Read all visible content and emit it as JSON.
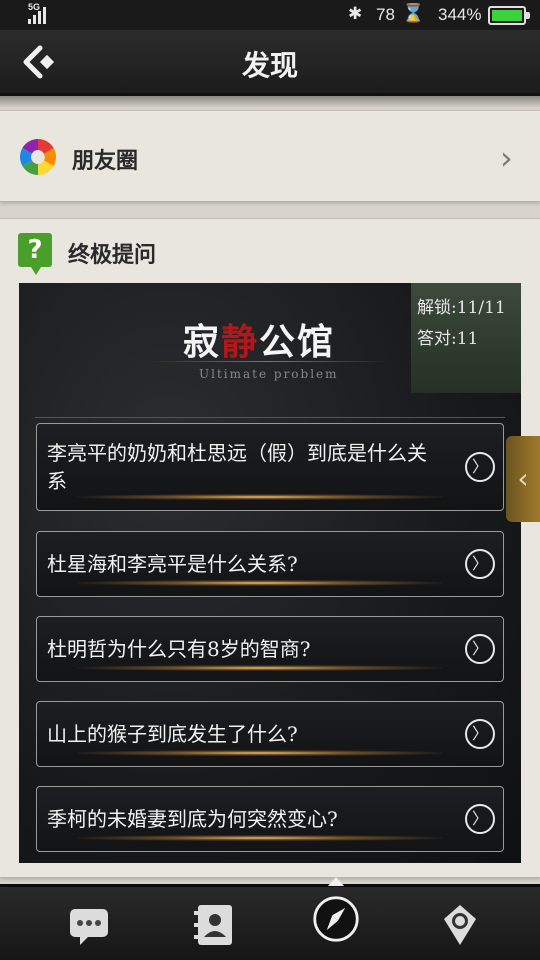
{
  "status_bar": {
    "network": "5G",
    "bluetooth_value": "78",
    "battery_percent": "344%",
    "colors": {
      "battery": "#3dd13d"
    }
  },
  "header": {
    "title": "发现",
    "back_icon": "back-arrow-icon"
  },
  "moments": {
    "label": "朋友圈",
    "icon": "aperture-icon"
  },
  "ultimate": {
    "label": "终极提问",
    "icon": "question-icon",
    "card": {
      "title_part1": "寂",
      "title_part2": "静",
      "title_part3": "公馆",
      "subtitle": "Ultimate problem",
      "unlock": "解锁:11/11",
      "correct": "答对:11"
    },
    "questions": [
      "李亮平的奶奶和杜思远（假）到底是什么关系",
      "杜星海和李亮平是什么关系?",
      "杜明哲为什么只有8岁的智商?",
      "山上的猴子到底发生了什么?",
      "季柯的未婚妻到底为何突然变心?"
    ]
  },
  "tabbar": {
    "tabs": [
      {
        "icon": "chat-bubble-icon"
      },
      {
        "icon": "contacts-icon"
      },
      {
        "icon": "compass-icon",
        "active": true
      },
      {
        "icon": "profile-icon"
      }
    ]
  }
}
